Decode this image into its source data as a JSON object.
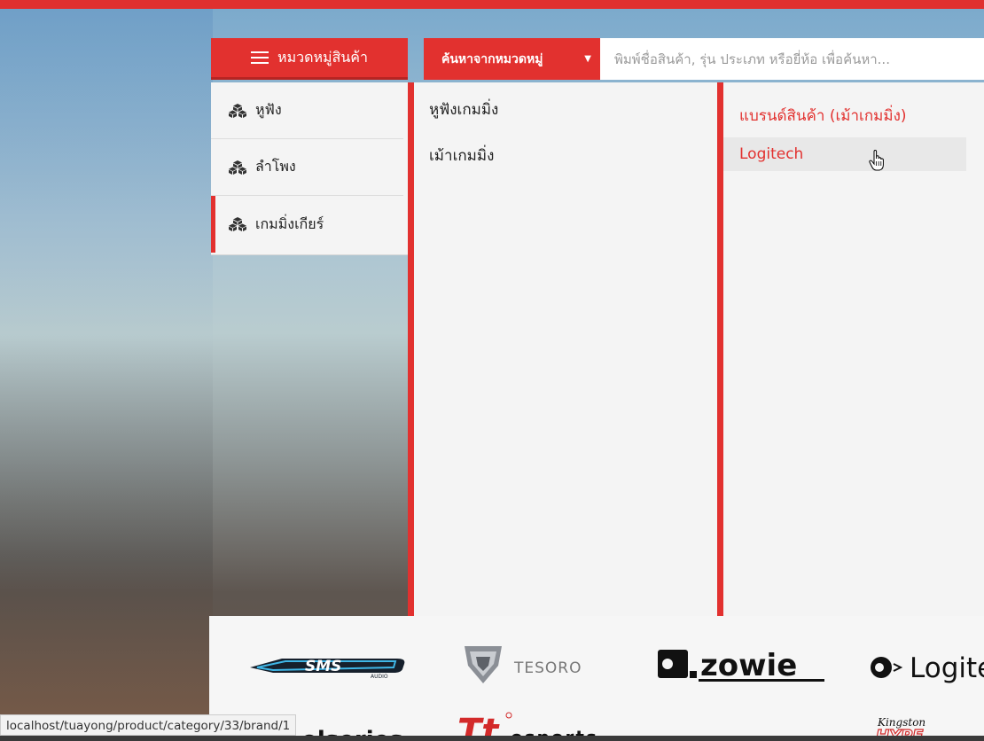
{
  "header": {
    "category_button_label": "หมวดหมู่สินค้า",
    "search_category_label": "ค้นหาจากหมวดหมู่",
    "search_placeholder": "พิมพ์ชื่อสินค้า, รุ่น ประเภท หรือยี่ห้อ เพื่อค้นหา..."
  },
  "categories": [
    {
      "label": "หูฟัง"
    },
    {
      "label": "ลำโพง"
    },
    {
      "label": "เกมมิ่งเกียร์"
    }
  ],
  "subcategories": [
    {
      "label": "หูฟังเกมมิ่ง"
    },
    {
      "label": "เม้าเกมมิ่ง"
    }
  ],
  "brands_panel": {
    "heading": "แบรนด์สินค้า (เม้าเกมมิ่ง)",
    "items": [
      {
        "label": "Logitech"
      }
    ]
  },
  "logos": {
    "sms": "SMS",
    "sms_sub": "AUDIO",
    "tesoro": "TESORO",
    "zowie": "zowie",
    "logitech": "Logite",
    "steelseries": "olseries",
    "tt": "Tt",
    "tt_sub": "esports",
    "kingston": "Kingston",
    "hyperx": "HYPE"
  },
  "status_bar": {
    "url": "localhost/tuayong/product/category/33/brand/1"
  },
  "colors": {
    "accent": "#e2312f",
    "panel_bg": "#f4f4f4"
  }
}
